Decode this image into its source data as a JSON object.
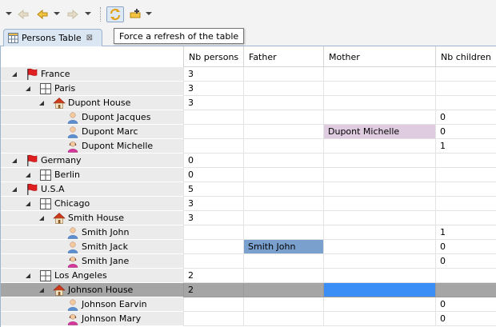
{
  "toolbar": {
    "buttons": [
      "back-disabled-icon",
      "back-icon",
      "forward-disabled-icon",
      "refresh-table-icon",
      "add-icon"
    ],
    "tooltip": "Force a refresh of the table"
  },
  "tab": {
    "label": "Persons Table",
    "close": "⊠"
  },
  "table": {
    "columns": [
      "Nb persons",
      "Father",
      "Mother",
      "Nb children"
    ],
    "rows": [
      {
        "label": "France",
        "icon": "flag-icon",
        "level": 0,
        "nb_persons": "3",
        "father": "",
        "mother": "",
        "nb_children": ""
      },
      {
        "label": "Paris",
        "icon": "city-icon",
        "level": 1,
        "nb_persons": "3",
        "father": "",
        "mother": "",
        "nb_children": ""
      },
      {
        "label": "Dupont House",
        "icon": "house-icon",
        "level": 2,
        "nb_persons": "3",
        "father": "",
        "mother": "",
        "nb_children": ""
      },
      {
        "label": "Dupont Jacques",
        "icon": "male-person-icon",
        "level": 3,
        "nb_persons": "",
        "father": "",
        "mother": "",
        "nb_children": "0"
      },
      {
        "label": "Dupont Marc",
        "icon": "male-person-icon",
        "level": 3,
        "nb_persons": "",
        "father": "",
        "mother": "Dupont Michelle",
        "nb_children": "0"
      },
      {
        "label": "Dupont Michelle",
        "icon": "female-person-icon",
        "level": 3,
        "nb_persons": "",
        "father": "",
        "mother": "",
        "nb_children": "1"
      },
      {
        "label": "Germany",
        "icon": "flag-icon",
        "level": 0,
        "nb_persons": "0",
        "father": "",
        "mother": "",
        "nb_children": ""
      },
      {
        "label": "Berlin",
        "icon": "city-icon",
        "level": 1,
        "nb_persons": "0",
        "father": "",
        "mother": "",
        "nb_children": ""
      },
      {
        "label": "U.S.A",
        "icon": "flag-icon",
        "level": 0,
        "nb_persons": "5",
        "father": "",
        "mother": "",
        "nb_children": ""
      },
      {
        "label": "Chicago",
        "icon": "city-icon",
        "level": 1,
        "nb_persons": "3",
        "father": "",
        "mother": "",
        "nb_children": ""
      },
      {
        "label": "Smith House",
        "icon": "house-icon",
        "level": 2,
        "nb_persons": "3",
        "father": "",
        "mother": "",
        "nb_children": ""
      },
      {
        "label": "Smith John",
        "icon": "male-person-icon",
        "level": 3,
        "nb_persons": "",
        "father": "",
        "mother": "",
        "nb_children": "1"
      },
      {
        "label": "Smith Jack",
        "icon": "male-person-icon",
        "level": 3,
        "nb_persons": "",
        "father": "Smith John",
        "mother": "",
        "nb_children": "0"
      },
      {
        "label": "Smith Jane",
        "icon": "female-person-icon",
        "level": 3,
        "nb_persons": "",
        "father": "",
        "mother": "",
        "nb_children": "0"
      },
      {
        "label": "Los Angeles",
        "icon": "city-icon",
        "level": 1,
        "nb_persons": "2",
        "father": "",
        "mother": "",
        "nb_children": ""
      },
      {
        "label": "Johnson House",
        "icon": "house-icon",
        "level": 2,
        "nb_persons": "2",
        "father": "",
        "mother": "",
        "nb_children": "",
        "selected": true
      },
      {
        "label": "Johnson Earvin",
        "icon": "male-person-icon",
        "level": 3,
        "nb_persons": "",
        "father": "",
        "mother": "",
        "nb_children": "0"
      },
      {
        "label": "Johnson Mary",
        "icon": "female-person-icon",
        "level": 3,
        "nb_persons": "",
        "father": "",
        "mother": "",
        "nb_children": "0"
      }
    ]
  },
  "colors": {
    "father_highlight": "#7aa0ce",
    "mother_highlight": "#e0cce0",
    "selected_row": "#a5a5a5",
    "selected_cell": "#3a8ef6"
  }
}
